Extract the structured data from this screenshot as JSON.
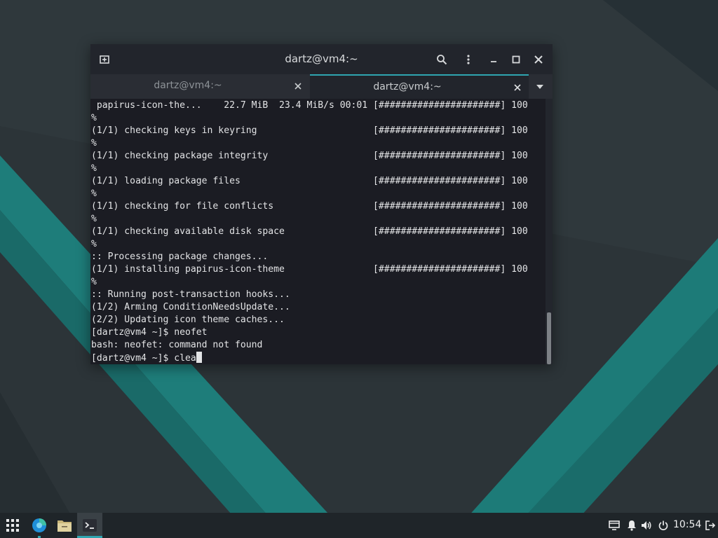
{
  "colors": {
    "accent": "#2fa5b0",
    "terminal_bg": "#1b1c23",
    "terminal_fg": "#e3e4e6",
    "taskbar_bg": "#1f2529"
  },
  "window": {
    "title": "dartz@vm4:~",
    "icons": {
      "new_tab": "new-tab-icon",
      "search": "search-icon",
      "menu": "kebab-menu-icon",
      "minimize": "minimize-icon",
      "maximize": "maximize-icon",
      "close": "close-icon"
    }
  },
  "tabs": [
    {
      "label": "dartz@vm4:~",
      "active": false
    },
    {
      "label": "dartz@vm4:~",
      "active": true
    }
  ],
  "terminal": {
    "lines": [
      " papirus-icon-the...    22.7 MiB  23.4 MiB/s 00:01 [######################] 100",
      "%",
      "(1/1) checking keys in keyring                     [######################] 100",
      "%",
      "(1/1) checking package integrity                   [######################] 100",
      "%",
      "(1/1) loading package files                        [######################] 100",
      "%",
      "(1/1) checking for file conflicts                  [######################] 100",
      "%",
      "(1/1) checking available disk space                [######################] 100",
      "%",
      ":: Processing package changes...",
      "(1/1) installing papirus-icon-theme                [######################] 100",
      "%",
      ":: Running post-transaction hooks...",
      "(1/2) Arming ConditionNeedsUpdate...",
      "(2/2) Updating icon theme caches...",
      "[dartz@vm4 ~]$ neofet",
      "bash: neofet: command not found",
      "[dartz@vm4 ~]$ clea"
    ],
    "scroll_position": 0.8
  },
  "taskbar": {
    "apps": [
      {
        "name": "app-grid-icon"
      },
      {
        "name": "browser-icon"
      },
      {
        "name": "file-manager-icon"
      },
      {
        "name": "terminal-icon",
        "active": true
      }
    ],
    "tray": [
      {
        "name": "network-icon"
      },
      {
        "name": "notification-bell-icon"
      },
      {
        "name": "volume-icon"
      },
      {
        "name": "power-icon"
      }
    ],
    "clock": "10:54",
    "logout_icon": "logout-icon"
  }
}
